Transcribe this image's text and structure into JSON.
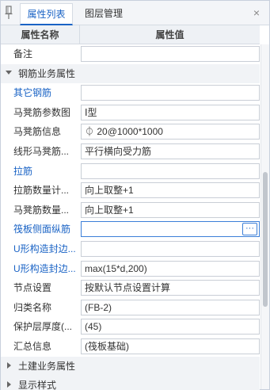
{
  "tabs": [
    {
      "label": "属性列表"
    },
    {
      "label": "图层管理"
    }
  ],
  "close_glyph": "×",
  "header": {
    "name": "属性名称",
    "value": "属性值"
  },
  "rows": [
    {
      "kind": "prop",
      "name": "备注",
      "value": "",
      "name_color": "default"
    },
    {
      "kind": "group",
      "name": "钢筋业务属性",
      "expanded": true
    },
    {
      "kind": "prop",
      "name": "其它钢筋",
      "value": "",
      "name_color": "blue"
    },
    {
      "kind": "prop",
      "name": "马凳筋参数图",
      "value": "Ⅰ型",
      "name_color": "default"
    },
    {
      "kind": "prop",
      "name": "马凳筋信息",
      "value": " 20@1000*1000",
      "rebar_symbol": "⏀",
      "name_color": "default"
    },
    {
      "kind": "prop",
      "name": "线形马凳筋...",
      "value": "平行横向受力筋",
      "name_color": "default"
    },
    {
      "kind": "prop",
      "name": "拉筋",
      "value": "",
      "name_color": "blue"
    },
    {
      "kind": "prop",
      "name": "拉筋数量计...",
      "value": "向上取整+1",
      "name_color": "default"
    },
    {
      "kind": "prop",
      "name": "马凳筋数量...",
      "value": "向上取整+1",
      "name_color": "default"
    },
    {
      "kind": "prop",
      "name": "筏板侧面纵筋",
      "value": "",
      "name_color": "blue",
      "active": true,
      "button": "···"
    },
    {
      "kind": "prop",
      "name": "U形构造封边...",
      "value": "",
      "name_color": "blue"
    },
    {
      "kind": "prop",
      "name": "U形构造封边...",
      "value": "max(15*d,200)",
      "name_color": "blue"
    },
    {
      "kind": "prop",
      "name": "节点设置",
      "value": "按默认节点设置计算",
      "name_color": "default"
    },
    {
      "kind": "prop",
      "name": "归类名称",
      "value": "(FB-2)",
      "name_color": "default"
    },
    {
      "kind": "prop",
      "name": "保护层厚度(...",
      "value": "(45)",
      "name_color": "default"
    },
    {
      "kind": "prop",
      "name": "汇总信息",
      "value": "(筏板基础)",
      "name_color": "default"
    },
    {
      "kind": "group",
      "name": "土建业务属性",
      "expanded": false
    },
    {
      "kind": "group",
      "name": "显示样式",
      "expanded": false
    }
  ],
  "colors": {
    "accent": "#1a63c5",
    "blue_label": "#1a63c5"
  }
}
